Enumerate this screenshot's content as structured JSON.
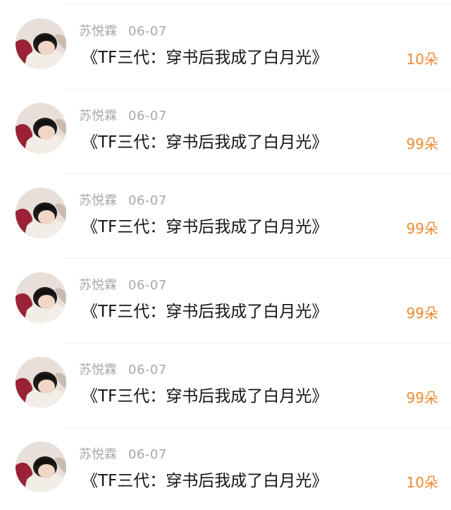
{
  "colors": {
    "amount": "#ee8a34",
    "meta": "#a8a8a8",
    "title": "#141414"
  },
  "items": [
    {
      "author": "苏悦霖",
      "date": "06-07",
      "title": "《TF三代：穿书后我成了白月光》",
      "amount": "10朵",
      "avatar_icon": "user-avatar"
    },
    {
      "author": "苏悦霖",
      "date": "06-07",
      "title": "《TF三代：穿书后我成了白月光》",
      "amount": "99朵",
      "avatar_icon": "user-avatar"
    },
    {
      "author": "苏悦霖",
      "date": "06-07",
      "title": "《TF三代：穿书后我成了白月光》",
      "amount": "99朵",
      "avatar_icon": "user-avatar"
    },
    {
      "author": "苏悦霖",
      "date": "06-07",
      "title": "《TF三代：穿书后我成了白月光》",
      "amount": "99朵",
      "avatar_icon": "user-avatar"
    },
    {
      "author": "苏悦霖",
      "date": "06-07",
      "title": "《TF三代：穿书后我成了白月光》",
      "amount": "99朵",
      "avatar_icon": "user-avatar"
    },
    {
      "author": "苏悦霖",
      "date": "06-07",
      "title": "《TF三代：穿书后我成了白月光》",
      "amount": "10朵",
      "avatar_icon": "user-avatar"
    }
  ]
}
